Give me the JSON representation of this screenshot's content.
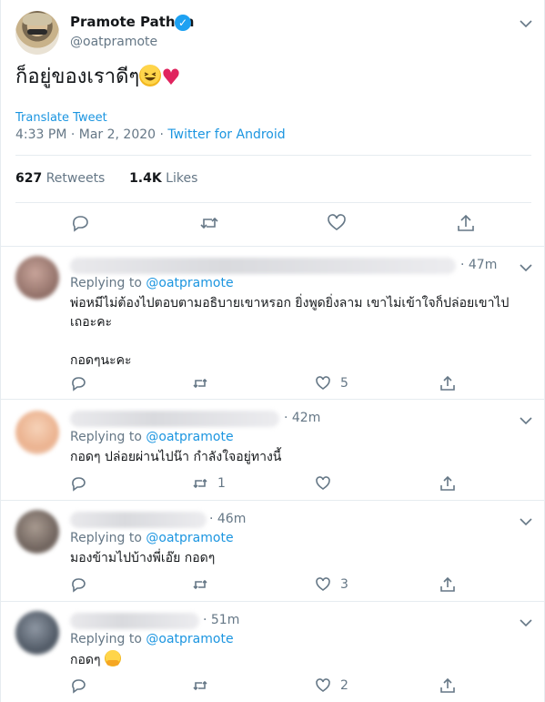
{
  "main_tweet": {
    "display_name": "Pramote Pathan",
    "handle": "@oatpramote",
    "text": "ก็อยู่ของเราดีๆ",
    "emoji": [
      "grinning-squinting-face",
      "red-heart"
    ],
    "translate_label": "Translate Tweet",
    "time": "4:33 PM · Mar 2, 2020 · ",
    "source": "Twitter for Android",
    "retweets_count": "627",
    "retweets_label": "Retweets",
    "likes_count": "1.4K",
    "likes_label": "Likes",
    "actions": [
      "reply-icon",
      "retweet-icon",
      "like-icon",
      "share-icon"
    ]
  },
  "replies": [
    {
      "time": "· 47m",
      "replying_prefix": "Replying to ",
      "replying_to": "@oatpramote",
      "text": "พ่อหมีไม่ต้องไปตอบตามอธิบายเขาหรอก ยิ่งพูดยิ่งลาม เขาไม่เข้าใจก็ปล่อยเขาไป\nเถอะคะ\n\nกอดๆนะคะ",
      "replies": "",
      "retweets": "",
      "likes": "5"
    },
    {
      "time": "· 42m",
      "replying_prefix": "Replying to ",
      "replying_to": "@oatpramote",
      "text": "กอดๆ ปล่อยผ่านไปน๊า กำลังใจอยู่ทางนี้",
      "replies": "",
      "retweets": "1",
      "likes": ""
    },
    {
      "time": "· 46m",
      "replying_prefix": "Replying to ",
      "replying_to": "@oatpramote",
      "text": "มองข้ามไปบ้างพี่เอ๊ย กอดๆ",
      "replies": "",
      "retweets": "",
      "likes": "3"
    },
    {
      "time": "· 51m",
      "replying_prefix": "Replying to ",
      "replying_to": "@oatpramote",
      "text": "กอดๆ",
      "emoji": "hugging-face",
      "replies": "",
      "retweets": "",
      "likes": "2"
    }
  ],
  "colors": {
    "accent": "#1b95e0",
    "muted": "#657786",
    "heart": "#e0245e",
    "verified": "#1da1f2"
  }
}
